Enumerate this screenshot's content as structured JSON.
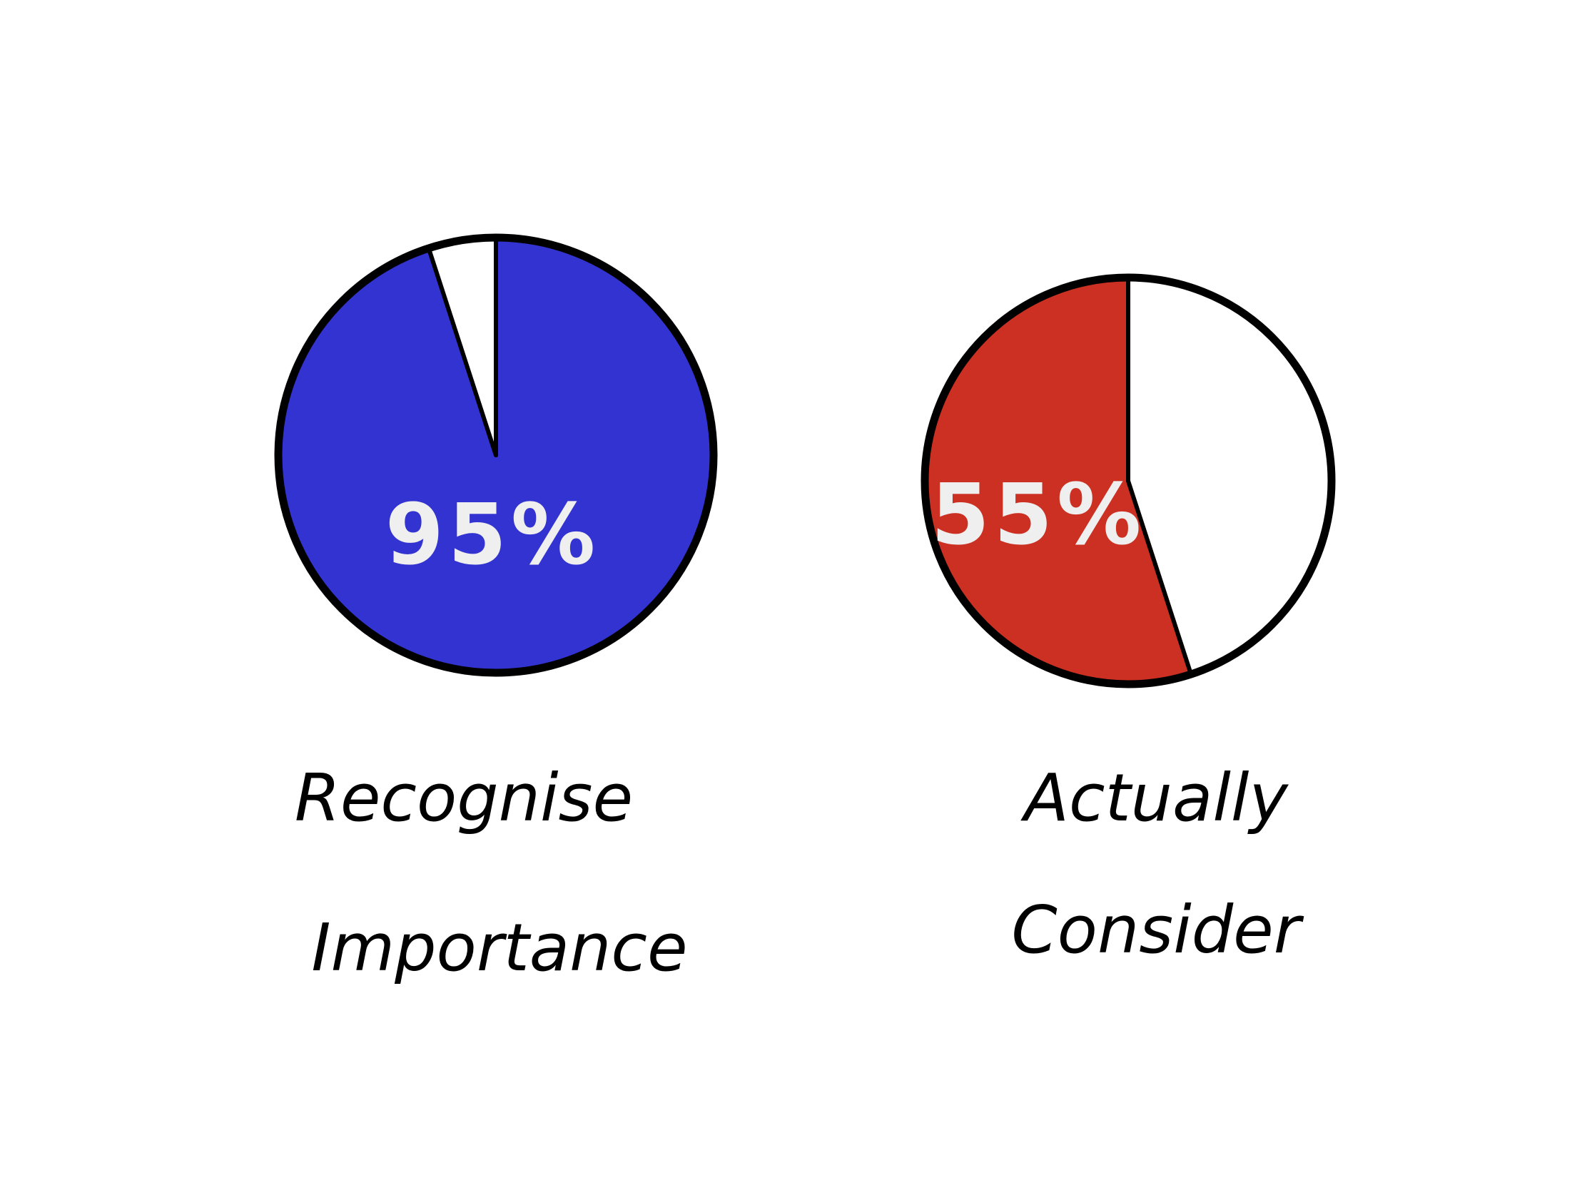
{
  "chart_data": [
    {
      "type": "pie",
      "title": "",
      "slices": [
        {
          "label": "Recognise Importance",
          "value": 95,
          "color": "#3333D1"
        },
        {
          "label": "",
          "value": 5,
          "color": "#FFFFFF"
        }
      ],
      "center_label": "95%",
      "caption_lines": [
        "Recognise",
        "Importance"
      ]
    },
    {
      "type": "pie",
      "title": "",
      "slices": [
        {
          "label": "Actually Consider",
          "value": 55,
          "color": "#CC3022"
        },
        {
          "label": "",
          "value": 45,
          "color": "#FFFFFF"
        }
      ],
      "center_label": "55%",
      "caption_lines": [
        "Actually",
        "Consider"
      ]
    }
  ]
}
